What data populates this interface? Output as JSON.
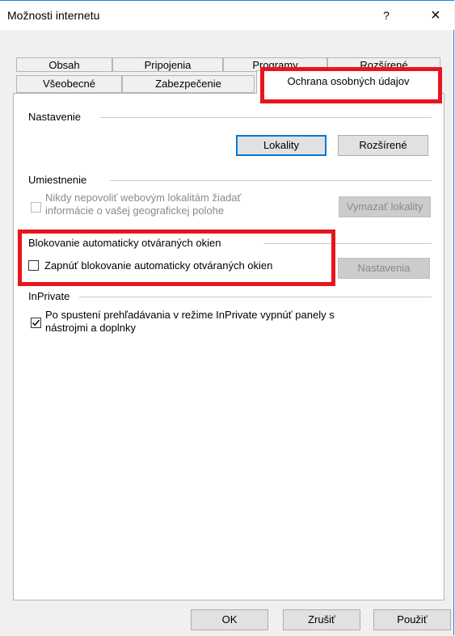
{
  "window": {
    "title": "Možnosti internetu",
    "help_label": "?",
    "close_label": "×"
  },
  "tabs": {
    "row1": [
      "Obsah",
      "Pripojenia",
      "Programy",
      "Rozšírené"
    ],
    "row2": [
      "Všeobecné",
      "Zabezpečenie",
      "Ochrana osobných údajov"
    ],
    "selected": "Ochrana osobných údajov"
  },
  "settings": {
    "group_label": "Nastavenie",
    "sites_button": "Lokality",
    "advanced_button": "Rozšírené"
  },
  "location": {
    "group_label": "Umiestnenie",
    "checkbox_label_line1": "Nikdy nepovoliť webovým lokalitám žiadať",
    "checkbox_label_line2": "informácie o vašej geografickej polohe",
    "checked": false,
    "clear_sites_button": "Vymazať lokality"
  },
  "popup_blocker": {
    "group_label": "Blokovanie automaticky otváraných okien",
    "checkbox_label": "Zapnúť blokovanie automaticky otváraných okien",
    "checked": false,
    "settings_button": "Nastavenia"
  },
  "inprivate": {
    "group_label": "InPrivate",
    "checkbox_label_line1": "Po spustení prehľadávania v režime InPrivate vypnúť panely s",
    "checkbox_label_line2": "nástrojmi a doplnky",
    "checked": true
  },
  "footer": {
    "ok_button": "OK",
    "cancel_button": "Zrušiť",
    "apply_button": "Použiť"
  },
  "colors": {
    "highlight": "#e8151f",
    "focus": "#0078d7"
  }
}
